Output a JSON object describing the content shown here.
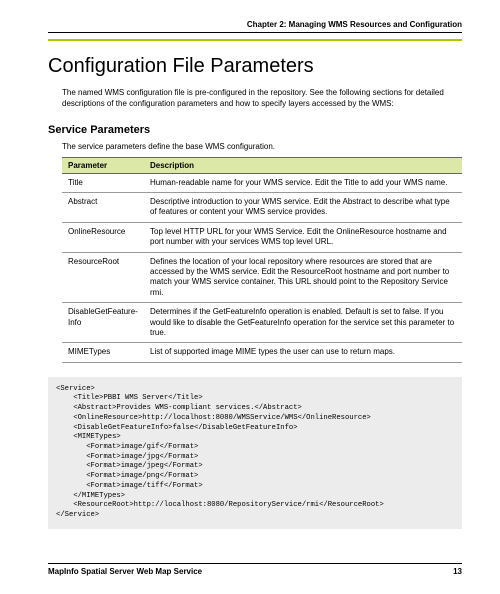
{
  "header": {
    "chapter": "Chapter 2: Managing WMS Resources and Configuration"
  },
  "title": "Configuration File Parameters",
  "intro": "The named WMS configuration file is pre-configured in the repository. See the following sections for detailed descriptions of the configuration parameters and how to specify layers accessed by the WMS:",
  "section": {
    "heading": "Service Parameters",
    "desc": "The service parameters define the base WMS configuration.",
    "table": {
      "headers": [
        "Parameter",
        "Description"
      ],
      "rows": [
        {
          "param": "Title",
          "desc": "Human-readable name for your WMS service. Edit the Title to add your WMS name."
        },
        {
          "param": "Abstract",
          "desc": "Descriptive introduction to your WMS service. Edit the Abstract to describe what type of features or content your WMS service provides."
        },
        {
          "param": "OnlineResource",
          "desc": "Top level HTTP URL for your WMS Service. Edit the OnlineResource hostname and port number with your services WMS top level URL."
        },
        {
          "param": "ResourceRoot",
          "desc": "Defines the location of your local repository where resources are stored that are accessed by the WMS service. Edit the ResourceRoot hostname and port number to match your WMS service container. This URL should point to the Repository Service rmi."
        },
        {
          "param": "DisableGetFeature-Info",
          "desc": "Determines if the GetFeatureInfo operation is enabled. Default is set to false. If you would like to disable the GetFeatureInfo operation for the service set this parameter to true."
        },
        {
          "param": "MIMETypes",
          "desc": "List of supported image MIME types the user can use to return maps."
        }
      ]
    }
  },
  "code": "<Service>\n    <Title>PBBI WMS Server</Title>\n    <Abstract>Provides WMS-compliant services.</Abstract>\n    <OnlineResource>http://localhost:8080/WMSService/WMS</OnlineResource>\n    <DisableGetFeatureInfo>false</DisableGetFeatureInfo>\n    <MIMETypes>\n       <Format>image/gif</Format>\n       <Format>image/jpg</Format>\n       <Format>image/jpeg</Format>\n       <Format>image/png</Format>\n       <Format>image/tiff</Format>\n    </MIMETypes>\n    <ResourceRoot>http://localhost:8080/RepositoryService/rmi</ResourceRoot>\n</Service>",
  "footer": {
    "product": "MapInfo Spatial Server Web Map Service",
    "page": "13"
  }
}
